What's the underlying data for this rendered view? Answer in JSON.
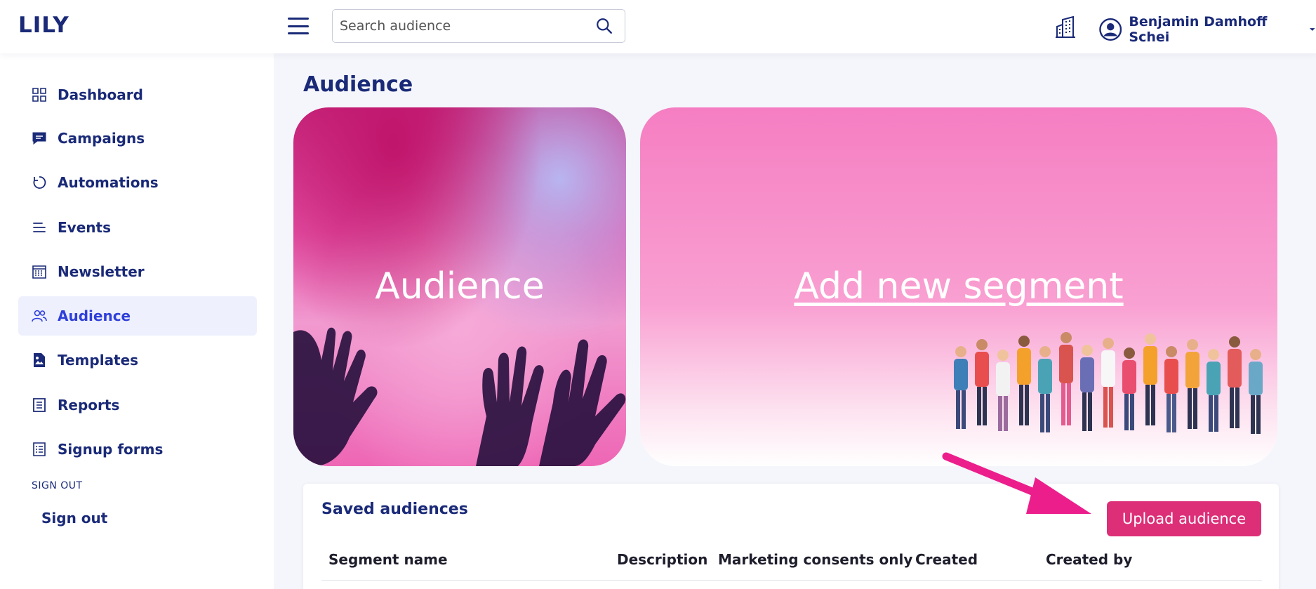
{
  "header": {
    "logo": "LILY",
    "search_placeholder": "Search audience",
    "user_name": "Benjamin Damhoff Schei"
  },
  "sidebar": {
    "items": [
      {
        "label": "Dashboard",
        "icon": "grid-icon"
      },
      {
        "label": "Campaigns",
        "icon": "chat-bubble-icon"
      },
      {
        "label": "Automations",
        "icon": "refresh-icon"
      },
      {
        "label": "Events",
        "icon": "lines-icon"
      },
      {
        "label": "Newsletter",
        "icon": "calendar-icon"
      },
      {
        "label": "Audience",
        "icon": "users-icon",
        "active": true
      },
      {
        "label": "Templates",
        "icon": "image-file-icon"
      },
      {
        "label": "Reports",
        "icon": "document-icon"
      },
      {
        "label": "Signup forms",
        "icon": "form-icon"
      }
    ],
    "section_label": "SIGN OUT",
    "signout_label": "Sign out"
  },
  "main": {
    "page_title": "Audience",
    "card_left_title": "Audience",
    "card_right_link": "Add new segment",
    "saved": {
      "title": "Saved audiences",
      "upload_label": "Upload audience",
      "columns": [
        "Segment name",
        "Description",
        "Marketing consents only",
        "Created",
        "Created by"
      ]
    }
  },
  "colors": {
    "brand": "#1a2a78",
    "accent": "#2f3fd9",
    "upload_button": "#dc2f78",
    "active_bg": "#eef0fe"
  }
}
